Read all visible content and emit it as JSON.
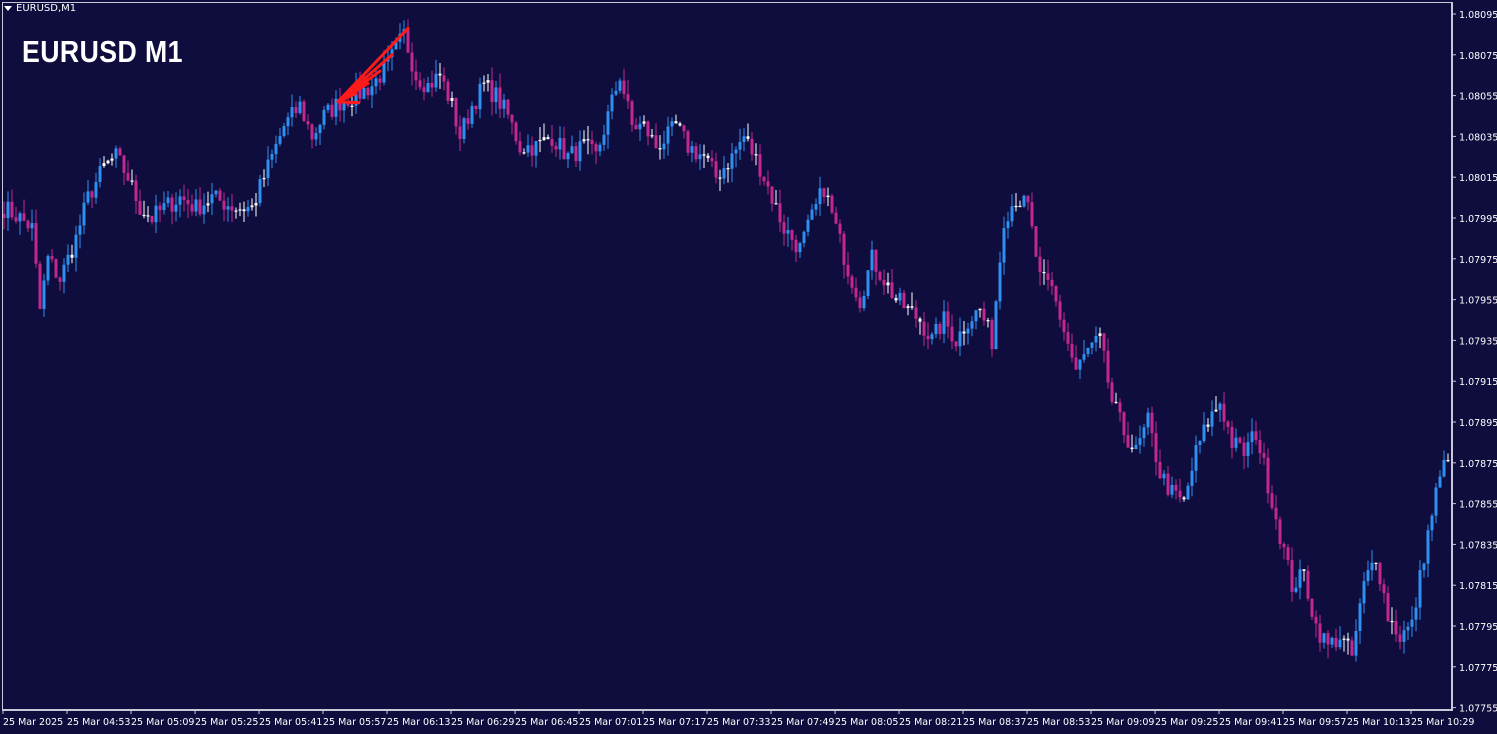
{
  "window": {
    "symbol_label": "EURUSD,M1",
    "title_overlay": "EURUSD M1"
  },
  "colors": {
    "background": "#0e0d3d",
    "bull": "#2f8ff0",
    "bear": "#c4288e",
    "doji": "#ffffff",
    "axis_text": "#ffffff",
    "annotation": "#ff1a1a"
  },
  "chart_data": {
    "type": "candlestick",
    "symbol": "EURUSD",
    "timeframe": "M1",
    "y_ticks": [
      "1.08095",
      "1.08075",
      "1.08055",
      "1.08035",
      "1.08015",
      "1.07995",
      "1.07975",
      "1.07955",
      "1.07935",
      "1.07915",
      "1.07895",
      "1.07875",
      "1.07855",
      "1.07835",
      "1.07815",
      "1.07795",
      "1.07775",
      "1.07755"
    ],
    "x_ticks": [
      "25 Mar 2025",
      "25 Mar 04:53",
      "25 Mar 05:09",
      "25 Mar 05:25",
      "25 Mar 05:41",
      "25 Mar 05:57",
      "25 Mar 06:13",
      "25 Mar 06:29",
      "25 Mar 06:45",
      "25 Mar 07:01",
      "25 Mar 07:17",
      "25 Mar 07:33",
      "25 Mar 07:49",
      "25 Mar 08:05",
      "25 Mar 08:21",
      "25 Mar 08:37",
      "25 Mar 08:53",
      "25 Mar 09:09",
      "25 Mar 09:25",
      "25 Mar 09:41",
      "25 Mar 09:57",
      "25 Mar 10:13",
      "25 Mar 10:29"
    ],
    "ylim": [
      1.07745,
      1.08102
    ],
    "close_path": [
      [
        0,
        1.08
      ],
      [
        4,
        1.07995
      ],
      [
        7,
        1.0799
      ],
      [
        9,
        1.0795
      ],
      [
        11,
        1.07975
      ],
      [
        14,
        1.07965
      ],
      [
        16,
        1.07975
      ],
      [
        18,
        1.07985
      ],
      [
        21,
        1.08005
      ],
      [
        25,
        1.0802
      ],
      [
        28,
        1.08025
      ],
      [
        31,
        1.08015
      ],
      [
        34,
        1.08
      ],
      [
        37,
        1.07995
      ],
      [
        40,
        1.08
      ],
      [
        44,
        1.08005
      ],
      [
        48,
        1.08
      ],
      [
        52,
        1.08005
      ],
      [
        58,
        1.08
      ],
      [
        62,
        1.08
      ],
      [
        66,
        1.0802
      ],
      [
        70,
        1.0804
      ],
      [
        74,
        1.0805
      ],
      [
        77,
        1.08035
      ],
      [
        80,
        1.08045
      ],
      [
        84,
        1.08052
      ],
      [
        88,
        1.08055
      ],
      [
        92,
        1.0806
      ],
      [
        96,
        1.0807
      ],
      [
        100,
        1.08085
      ],
      [
        103,
        1.08065
      ],
      [
        106,
        1.0806
      ],
      [
        109,
        1.08065
      ],
      [
        112,
        1.0805
      ],
      [
        114,
        1.08035
      ],
      [
        117,
        1.0805
      ],
      [
        120,
        1.0806
      ],
      [
        123,
        1.08055
      ],
      [
        126,
        1.08045
      ],
      [
        129,
        1.0803
      ],
      [
        133,
        1.0803
      ],
      [
        137,
        1.08035
      ],
      [
        141,
        1.08025
      ],
      [
        145,
        1.0803
      ],
      [
        148,
        1.08025
      ],
      [
        151,
        1.08045
      ],
      [
        154,
        1.08065
      ],
      [
        157,
        1.0804
      ],
      [
        160,
        1.0804
      ],
      [
        163,
        1.0803
      ],
      [
        166,
        1.08035
      ],
      [
        168,
        1.0804
      ],
      [
        171,
        1.0803
      ],
      [
        175,
        1.08025
      ],
      [
        178,
        1.08015
      ],
      [
        182,
        1.08025
      ],
      [
        185,
        1.08035
      ],
      [
        189,
        1.0802
      ],
      [
        192,
        1.08005
      ],
      [
        195,
        1.0799
      ],
      [
        199,
        1.0798
      ],
      [
        202,
        1.07995
      ],
      [
        205,
        1.0801
      ],
      [
        208,
        1.0799
      ],
      [
        211,
        1.0797
      ],
      [
        214,
        1.07955
      ],
      [
        217,
        1.07975
      ],
      [
        220,
        1.07965
      ],
      [
        223,
        1.07955
      ],
      [
        226,
        1.0795
      ],
      [
        229,
        1.07945
      ],
      [
        232,
        1.07935
      ],
      [
        235,
        1.07945
      ],
      [
        238,
        1.07935
      ],
      [
        241,
        1.07945
      ],
      [
        244,
        1.0795
      ],
      [
        247,
        1.07935
      ],
      [
        250,
        1.07995
      ],
      [
        253,
        1.08005
      ],
      [
        256,
        1.08
      ],
      [
        259,
        1.07965
      ],
      [
        262,
        1.0796
      ],
      [
        265,
        1.0794
      ],
      [
        268,
        1.0792
      ],
      [
        271,
        1.0793
      ],
      [
        274,
        1.07935
      ],
      [
        277,
        1.07905
      ],
      [
        280,
        1.0789
      ],
      [
        283,
        1.0788
      ],
      [
        286,
        1.07895
      ],
      [
        289,
        1.0787
      ],
      [
        292,
        1.0786
      ],
      [
        295,
        1.07855
      ],
      [
        298,
        1.0788
      ],
      [
        301,
        1.07895
      ],
      [
        304,
        1.07905
      ],
      [
        307,
        1.07885
      ],
      [
        310,
        1.0788
      ],
      [
        313,
        1.0789
      ],
      [
        316,
        1.07865
      ],
      [
        319,
        1.0784
      ],
      [
        322,
        1.07815
      ],
      [
        325,
        1.0782
      ],
      [
        328,
        1.07795
      ],
      [
        331,
        1.07785
      ],
      [
        334,
        1.0779
      ],
      [
        337,
        1.0778
      ],
      [
        340,
        1.07815
      ],
      [
        343,
        1.0783
      ],
      [
        346,
        1.078
      ],
      [
        349,
        1.0779
      ],
      [
        352,
        1.07795
      ],
      [
        355,
        1.0783
      ],
      [
        358,
        1.0786
      ],
      [
        361,
        1.0788
      ],
      [
        365,
        1.07905
      ]
    ],
    "annotation": {
      "type": "fan",
      "apex": [
        84,
        1.08052
      ],
      "points": [
        [
          101,
          1.08088
        ],
        [
          97,
          1.08075
        ],
        [
          94,
          1.08067
        ],
        [
          91,
          1.08061
        ],
        [
          88,
          1.08056
        ]
      ]
    }
  }
}
